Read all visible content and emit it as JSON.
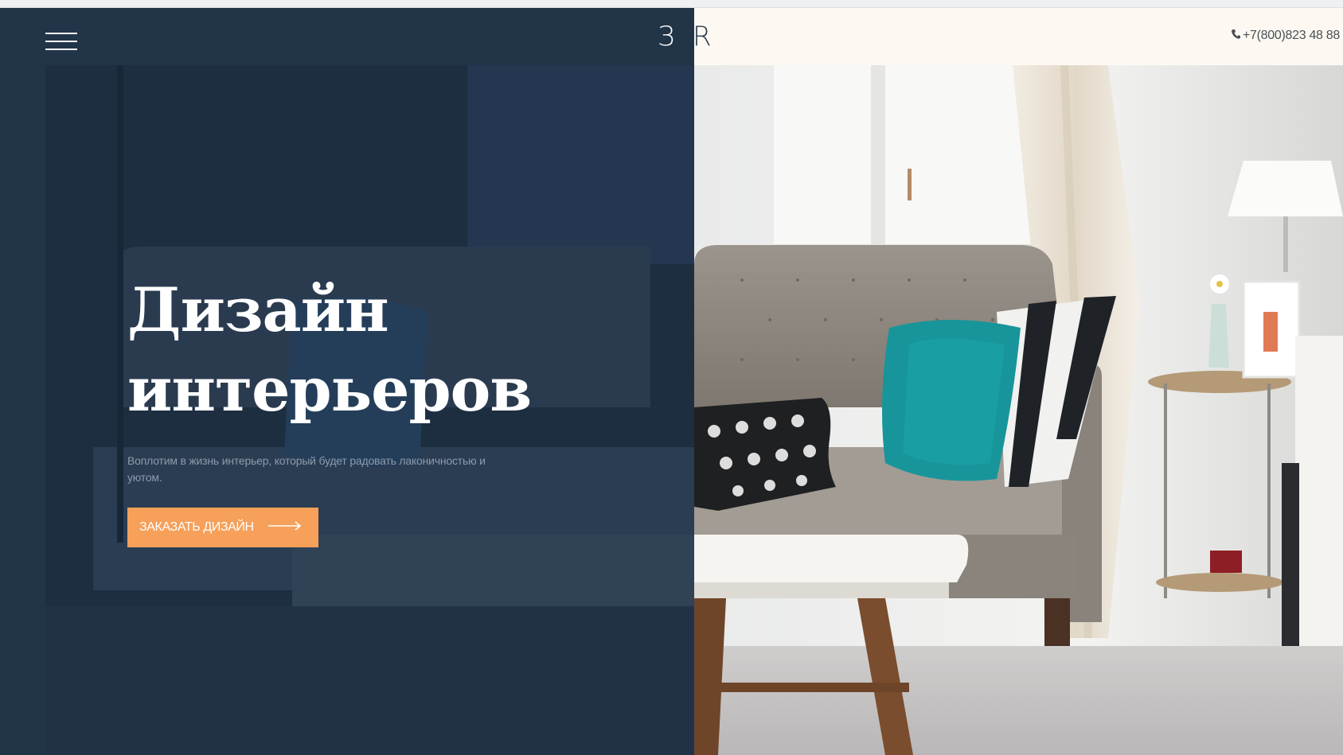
{
  "header": {
    "logo_left": "З",
    "logo_right": "R",
    "phone": "+7(800)823 48 88",
    "phone_icon": "phone-icon",
    "menu_icon": "hamburger-menu-icon"
  },
  "hero": {
    "title_line1": "Дизайн",
    "title_line2": "интерьеров",
    "subtitle": "Воплотим в жизнь интерьер, который будет радовать лаконичностью и уютом.",
    "cta_label": "ЗАКАЗАТЬ ДИЗАЙН",
    "cta_icon": "long-arrow-right-icon"
  },
  "colors": {
    "dark_panel": "#223448",
    "accent": "#f6a05a",
    "header_strip": "#fdf9f2",
    "text_light": "#ffffff",
    "subtitle": "#8d9aab"
  }
}
